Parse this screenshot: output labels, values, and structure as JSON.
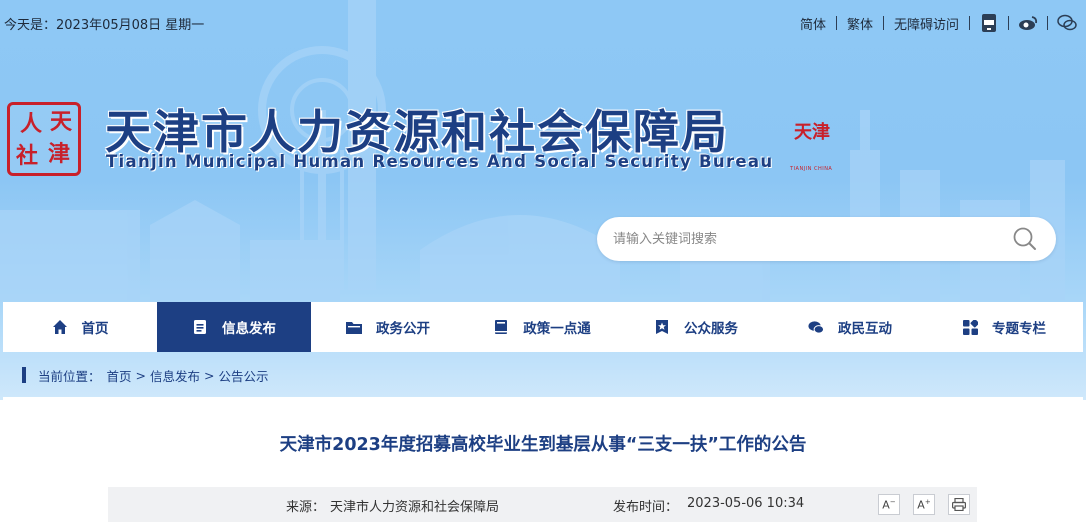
{
  "topbar": {
    "date_text": "今天是：2023年05月08日 星期一",
    "links": [
      {
        "label": "简体"
      },
      {
        "label": "繁体"
      },
      {
        "label": "无障碍访问"
      }
    ],
    "icons": [
      "app-icon",
      "weibo-icon",
      "wechat-icon"
    ]
  },
  "header": {
    "seal_chars": [
      "人",
      "天",
      "社",
      "津"
    ],
    "title": "天津市人力资源和社会保障局",
    "subtitle": "Tianjin Municipal Human Resources And Social Security Bureau",
    "city_stamp": {
      "chars": "天津",
      "small": "TIANJIN CHINA"
    }
  },
  "search": {
    "placeholder": "请输入关键词搜索",
    "icon": "search-icon"
  },
  "nav": {
    "items": [
      {
        "label": "首页",
        "icon": "home-icon",
        "active": false
      },
      {
        "label": "信息发布",
        "icon": "document-icon",
        "active": true
      },
      {
        "label": "政务公开",
        "icon": "folder-icon",
        "active": false
      },
      {
        "label": "政策一点通",
        "icon": "book-icon",
        "active": false
      },
      {
        "label": "公众服务",
        "icon": "star-icon",
        "active": false
      },
      {
        "label": "政民互动",
        "icon": "chat-icon",
        "active": false
      },
      {
        "label": "专题专栏",
        "icon": "grid-icon",
        "active": false
      }
    ]
  },
  "breadcrumb": {
    "prefix": "当前位置：",
    "items": [
      "首页",
      "信息发布",
      "公告公示"
    ],
    "separator": ">"
  },
  "article": {
    "title": "天津市2023年度招募高校毕业生到基层从事“三支一扶”工作的公告",
    "source_label": "来源：",
    "source": "天津市人力资源和社会保障局",
    "time_label": "发布时间：",
    "time": "2023-05-06 10:34",
    "tools": [
      {
        "label": "A-",
        "icon": "font-decrease-icon"
      },
      {
        "label": "A+",
        "icon": "font-increase-icon"
      },
      {
        "label": "",
        "icon": "print-icon"
      }
    ]
  },
  "colors": {
    "brand": "#1d3f83",
    "seal_red": "#c8202a",
    "sky": "#8ec8f5"
  }
}
